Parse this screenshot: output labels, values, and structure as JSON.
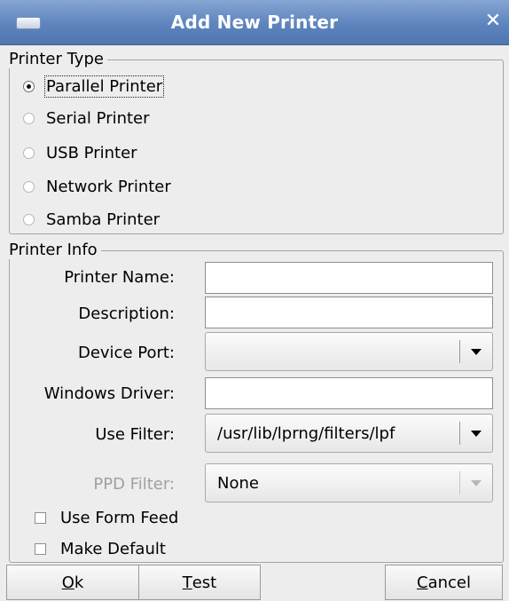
{
  "window": {
    "title": "Add New Printer"
  },
  "printer_type": {
    "legend": "Printer Type",
    "options": [
      {
        "label": "Parallel Printer",
        "selected": true
      },
      {
        "label": "Serial Printer",
        "selected": false
      },
      {
        "label": "USB Printer",
        "selected": false
      },
      {
        "label": "Network Printer",
        "selected": false
      },
      {
        "label": "Samba Printer",
        "selected": false
      }
    ]
  },
  "printer_info": {
    "legend": "Printer Info",
    "printer_name": {
      "label": "Printer Name:",
      "value": ""
    },
    "description": {
      "label": "Description:",
      "value": ""
    },
    "device_port": {
      "label": "Device Port:",
      "value": ""
    },
    "windows_driver": {
      "label": "Windows Driver:",
      "value": ""
    },
    "use_filter": {
      "label": "Use Filter:",
      "value": "/usr/lib/lprng/filters/lpf"
    },
    "ppd_filter": {
      "label": "PPD Filter:",
      "value": "None",
      "enabled": false
    }
  },
  "options": {
    "use_form_feed": {
      "label": "Use Form Feed",
      "checked": false
    },
    "make_default": {
      "label": "Make Default",
      "checked": false
    }
  },
  "buttons": {
    "ok": {
      "mnemonic": "O",
      "rest": "k"
    },
    "test": {
      "mnemonic": "T",
      "rest": "est"
    },
    "cancel": {
      "mnemonic": "C",
      "rest": "ancel"
    }
  }
}
